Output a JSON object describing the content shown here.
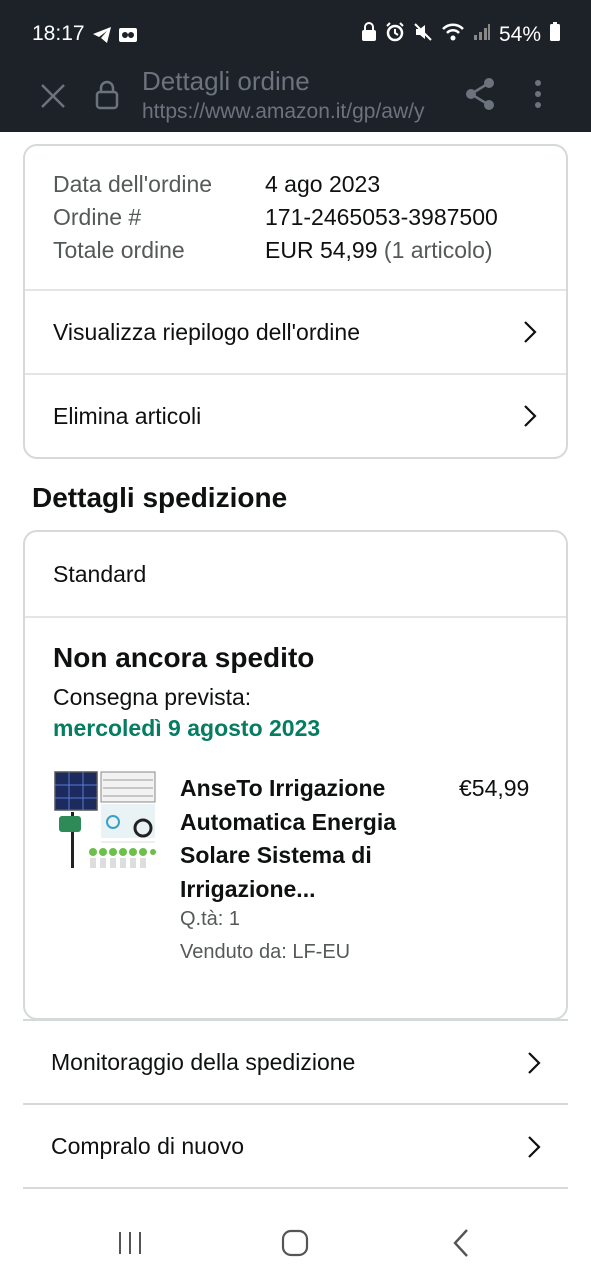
{
  "status": {
    "time": "18:17",
    "battery": "54%"
  },
  "browser": {
    "title": "Dettagli ordine",
    "url": "https://www.amazon.it/gp/aw/y"
  },
  "order": {
    "date_label": "Data dell'ordine",
    "date_value": "4 ago 2023",
    "number_label": "Ordine #",
    "number_value": "171-2465053-3987500",
    "total_label": "Totale ordine",
    "total_value": "EUR 54,99",
    "total_count": "(1 articolo)",
    "summary_link": "Visualizza riepilogo dell'ordine",
    "delete_link": "Elimina articoli"
  },
  "shipping": {
    "section_title": "Dettagli spedizione",
    "method": "Standard",
    "status": "Non ancora spedito",
    "delivery_label": "Consegna prevista:",
    "delivery_date": "mercoledì 9 agosto 2023",
    "delivery_date_color": "#067d62"
  },
  "item": {
    "title_line1": "AnseTo Irrigazione",
    "title_line2": "Automatica Energia",
    "title_line3": "Solare Sistema di",
    "title_line4": "Irrigazione...",
    "price": "€54,99",
    "quantity": "Q.tà: 1",
    "seller": "Venduto da: LF-EU"
  },
  "actions": {
    "tracking": "Monitoraggio della spedizione",
    "buy_again": "Compralo di nuovo"
  },
  "icons": {
    "close": "close-icon",
    "lock": "lock-icon",
    "share": "share-icon",
    "more": "more-vert-icon",
    "chevron": "chevron-right-icon"
  }
}
